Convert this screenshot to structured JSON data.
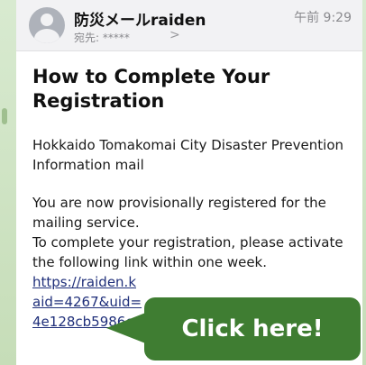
{
  "email": {
    "sender": "防災メールraiden",
    "time": "午前 9:29",
    "recipient_label": "宛先: *****",
    "chevron": ">",
    "subject": "How to Complete Your Registration",
    "body": {
      "line1": "Hokkaido Tomakomai City Disaster Prevention Information mail",
      "line2": "You are now provisionally registered for the mailing service.",
      "line3": "To complete your registration, please activate the following link within one week.",
      "link_line1": "https://raiden.k",
      "link_line2": "aid=4267&uid=",
      "link_line3": "4e128cb5986c"
    }
  },
  "callout": {
    "label": "Click here!"
  },
  "colors": {
    "accent": "#3f7d32",
    "link": "#1f2f7a",
    "header_bg": "#f2f2f4"
  }
}
